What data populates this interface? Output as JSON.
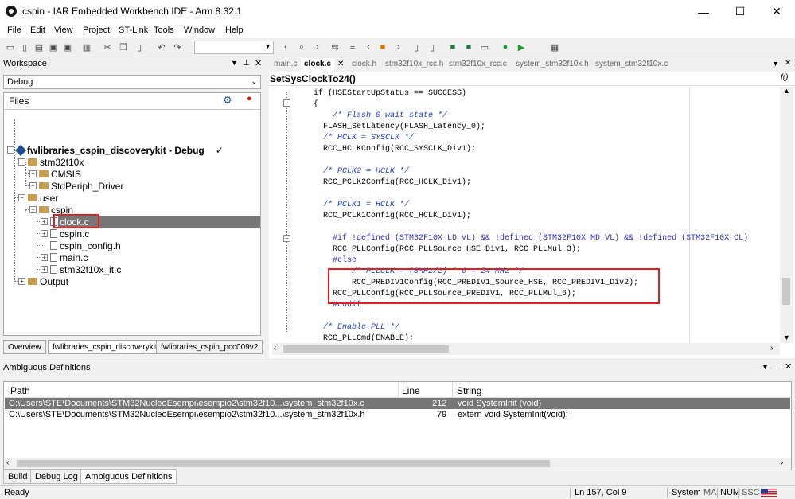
{
  "window": {
    "title": "cspin - IAR Embedded Workbench IDE - Arm 8.32.1",
    "minimize": "—",
    "maximize": "☐",
    "close": "✕"
  },
  "menu": [
    "File",
    "Edit",
    "View",
    "Project",
    "ST-Link",
    "Tools",
    "Window",
    "Help"
  ],
  "workspace": {
    "title": "Workspace",
    "config": "Debug",
    "files_header": "Files",
    "project": "fwlibraries_cspin_discoverykit - Debug",
    "project_check": "✓",
    "tree": [
      {
        "label": "stm32f10x",
        "kind": "folder"
      },
      {
        "label": "CMSIS",
        "kind": "folder"
      },
      {
        "label": "StdPeriph_Driver",
        "kind": "folder"
      },
      {
        "label": "user",
        "kind": "folder"
      },
      {
        "label": "cspin",
        "kind": "folder"
      },
      {
        "label": "clock.c",
        "kind": "file",
        "selected": true
      },
      {
        "label": "cspin.c",
        "kind": "file"
      },
      {
        "label": "cspin_config.h",
        "kind": "file"
      },
      {
        "label": "main.c",
        "kind": "file"
      },
      {
        "label": "stm32f10x_it.c",
        "kind": "file"
      },
      {
        "label": "Output",
        "kind": "folder"
      }
    ],
    "tabs": [
      "Overview",
      "fwlibraries_cspin_discoverykit",
      "fwlibraries_cspin_pcc009v2"
    ]
  },
  "editor": {
    "tabs": [
      "main.c",
      "clock.c",
      "clock.h",
      "stm32f10x_rcc.h",
      "stm32f10x_rcc.c",
      "system_stm32f10x.h",
      "system_stm32f10x.c"
    ],
    "active_tab": "clock.c",
    "function_name": "SetSysClockTo24()",
    "function_icon": "f()",
    "lines": [
      "    if (HSEStartUpStatus == SUCCESS)",
      "    {",
      "        /* Flash 0 wait state */",
      "      FLASH_SetLatency(FLASH_Latency_0);",
      "      /* HCLK = SYSCLK */",
      "      RCC_HCLKConfig(RCC_SYSCLK_Div1);",
      "",
      "      /* PCLK2 = HCLK */",
      "      RCC_PCLK2Config(RCC_HCLK_Div1);",
      "",
      "      /* PCLK1 = HCLK */",
      "      RCC_PCLK1Config(RCC_HCLK_Div1);",
      "",
      "        #if !defined (STM32F10X_LD_VL) && !defined (STM32F10X_MD_VL) && !defined (STM32F10X_CL)",
      "        RCC_PLLConfig(RCC_PLLSource_HSE_Div1, RCC_PLLMul_3);",
      "        #else",
      "            /* PLLCLK = (8MHz/2) * 6 = 24 MHz */",
      "            RCC_PREDIV1Config(RCC_PREDIV1_Source_HSE, RCC_PREDIV1_Div2);",
      "        RCC_PLLConfig(RCC_PLLSource_PREDIV1, RCC_PLLMul_6);",
      "        #endif",
      "",
      "      /* Enable PLL */",
      "      RCC_PLLCmd(ENABLE);"
    ]
  },
  "ambiguous": {
    "title": "Ambiguous Definitions",
    "columns": [
      "Path",
      "Line",
      "String"
    ],
    "rows": [
      {
        "path": "C:\\Users\\STE\\Documents\\STM32NucleoEsempi\\esempio2\\stm32f10...\\system_stm32f10x.c",
        "line": "212",
        "string": "void SystemInit (void)"
      },
      {
        "path": "C:\\Users\\STE\\Documents\\STM32NucleoEsempi\\esempio2\\stm32f10...\\system_stm32f10x.h",
        "line": "79",
        "string": "extern void SystemInit(void);"
      }
    ]
  },
  "bottom_tabs": [
    "Build",
    "Debug Log",
    "Ambiguous Definitions"
  ],
  "status": {
    "ready": "Ready",
    "position": "Ln 157, Col 9",
    "system": "System",
    "ma": "MA",
    "num": "NUM",
    "ssc": "SSC"
  },
  "colors": {
    "highlight_red": "#e02020",
    "selection_gray": "#777777",
    "comment_blue": "#1e3fcf"
  }
}
